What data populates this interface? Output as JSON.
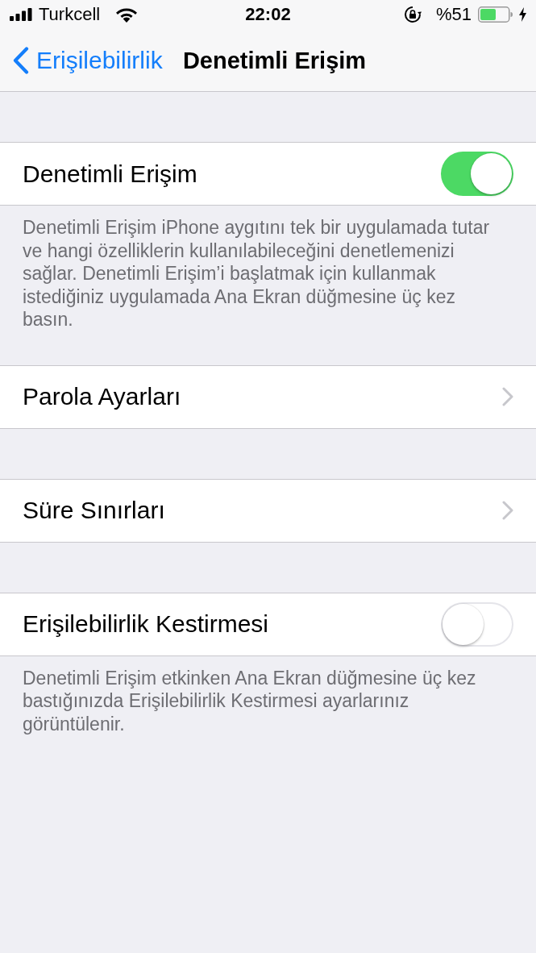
{
  "status_bar": {
    "carrier": "Turkcell",
    "time": "22:02",
    "battery_percent": "%51"
  },
  "nav_bar": {
    "back_label": "Erişilebilirlik",
    "title": "Denetimli Erişim"
  },
  "groups": [
    {
      "rows": [
        {
          "kind": "toggle",
          "label": "Denetimli Erişim",
          "on": true
        }
      ],
      "footer": "Denetimli Erişim iPhone aygıtını tek bir uygulamada tutar ve hangi özelliklerin kullanılabileceğini denetlemenizi sağlar. Denetimli Erişim’i başlatmak için kullanmak istediğiniz uygulamada Ana Ekran düğmesine üç kez basın."
    },
    {
      "rows": [
        {
          "kind": "link",
          "label": "Parola Ayarları"
        }
      ]
    },
    {
      "rows": [
        {
          "kind": "link",
          "label": "Süre Sınırları"
        }
      ]
    },
    {
      "rows": [
        {
          "kind": "toggle",
          "label": "Erişilebilirlik Kestirmesi",
          "on": false
        }
      ],
      "footer": "Denetimli Erişim etkinken Ana Ekran düğmesine üç kez bastığınızda Erişilebilirlik Kestirmesi ayarlarınız görüntülenir."
    }
  ]
}
